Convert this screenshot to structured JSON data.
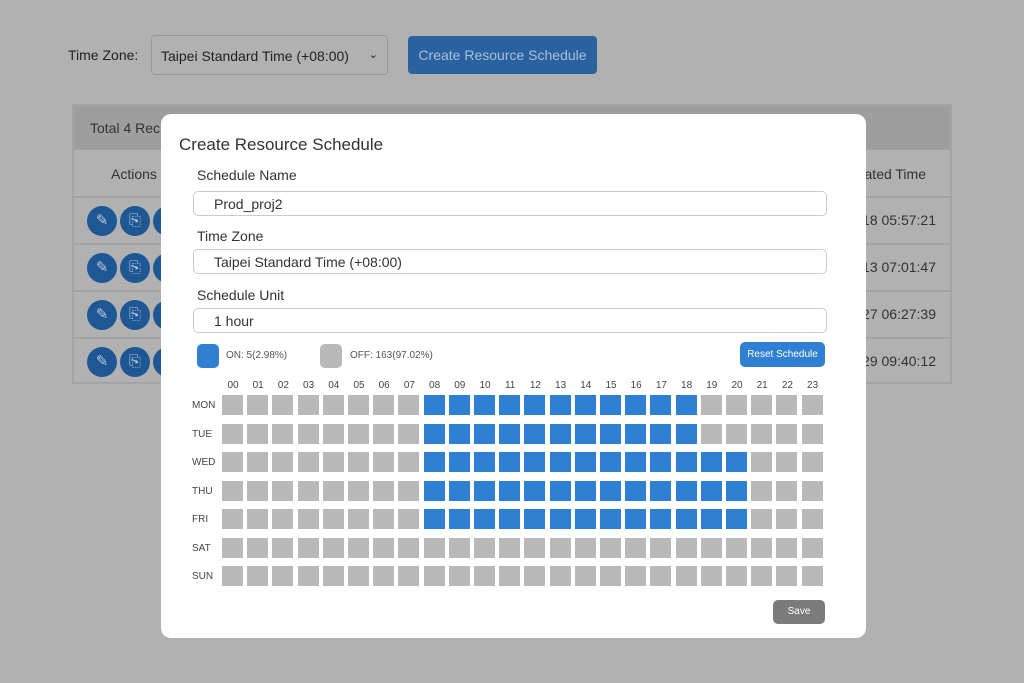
{
  "page": {
    "timezone_label": "Time Zone:",
    "timezone_value": "Taipei Standard Time (+08:00)",
    "create_button": "Create Resource Schedule"
  },
  "table": {
    "total": "Total 4 Rec",
    "col_actions": "Actions",
    "col_time": "ated Time",
    "rows": [
      {
        "time": "18 05:57:21"
      },
      {
        "time": "13 07:01:47"
      },
      {
        "time": "27 06:27:39"
      },
      {
        "time": "29 09:40:12"
      }
    ]
  },
  "modal": {
    "title": "Create Resource Schedule",
    "schedule_name_label": "Schedule Name",
    "schedule_name": "Prod_proj2",
    "timezone_label": "Time Zone",
    "timezone": "Taipei Standard Time (+08:00)",
    "unit_label": "Schedule Unit",
    "unit": "1 hour",
    "legend_on": "ON: 5(2.98%)",
    "legend_off": "OFF: 163(97.02%)",
    "reset_button": "Reset Schedule",
    "save_button": "Save",
    "on_color": "#2f80d2",
    "off_color": "#b9b9b9",
    "hours": [
      "00",
      "01",
      "02",
      "03",
      "04",
      "05",
      "06",
      "07",
      "08",
      "09",
      "10",
      "11",
      "12",
      "13",
      "14",
      "15",
      "16",
      "17",
      "18",
      "19",
      "20",
      "21",
      "22",
      "23"
    ],
    "days": [
      {
        "label": "MON",
        "on": [
          8,
          9,
          10,
          11,
          12,
          13,
          14,
          15,
          16,
          17,
          18
        ]
      },
      {
        "label": "TUE",
        "on": [
          8,
          9,
          10,
          11,
          12,
          13,
          14,
          15,
          16,
          17,
          18
        ]
      },
      {
        "label": "WED",
        "on": [
          8,
          9,
          10,
          11,
          12,
          13,
          14,
          15,
          16,
          17,
          18,
          19,
          20
        ]
      },
      {
        "label": "THU",
        "on": [
          8,
          9,
          10,
          11,
          12,
          13,
          14,
          15,
          16,
          17,
          18,
          19,
          20
        ]
      },
      {
        "label": "FRI",
        "on": [
          8,
          9,
          10,
          11,
          12,
          13,
          14,
          15,
          16,
          17,
          18,
          19,
          20
        ]
      },
      {
        "label": "SAT",
        "on": []
      },
      {
        "label": "SUN",
        "on": []
      }
    ]
  }
}
